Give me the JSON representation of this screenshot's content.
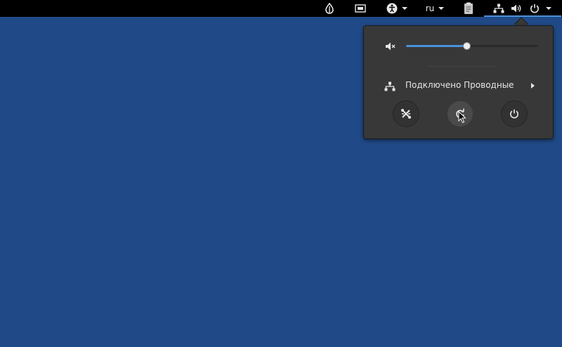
{
  "topbar": {
    "indicators": [
      {
        "name": "update-indicator",
        "icon": "drop-icon"
      },
      {
        "name": "screen-indicator",
        "icon": "display-icon"
      },
      {
        "name": "accessibility-menu",
        "icon": "accessibility-icon"
      },
      {
        "name": "keyboard-layout",
        "label": "ru"
      },
      {
        "name": "clipboard",
        "icon": "clipboard-icon"
      },
      {
        "name": "system-menu",
        "icons": [
          "network-wired-icon",
          "volume-icon",
          "power-icon"
        ]
      }
    ],
    "language": "ru"
  },
  "popup": {
    "volume": {
      "level": 0.46,
      "icon": "volume-muted-icon"
    },
    "network": {
      "label": "Подключено Проводные",
      "icon": "network-wired-icon"
    },
    "actions": [
      {
        "name": "settings",
        "icon": "settings-icon"
      },
      {
        "name": "lock",
        "icon": "lock-rotation-icon"
      },
      {
        "name": "power-off",
        "icon": "power-icon"
      }
    ]
  },
  "colors": {
    "desktop": "#204a87",
    "topbar": "#000000",
    "popup": "#383838",
    "accent": "#4a90d9",
    "text": "#e6e6e6"
  }
}
